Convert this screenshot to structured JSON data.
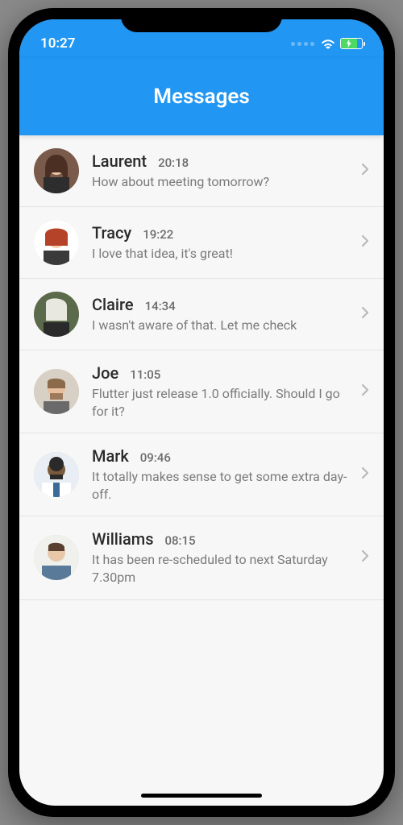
{
  "statusbar": {
    "time": "10:27"
  },
  "appbar": {
    "title": "Messages"
  },
  "conversations": [
    {
      "name": "Laurent",
      "time": "20:18",
      "preview": "How about meeting tomorrow?",
      "avatar": "avatar-1"
    },
    {
      "name": "Tracy",
      "time": "19:22",
      "preview": "I love that idea, it's great!",
      "avatar": "avatar-2"
    },
    {
      "name": "Claire",
      "time": "14:34",
      "preview": "I wasn't aware of that. Let me check",
      "avatar": "avatar-3"
    },
    {
      "name": "Joe",
      "time": "11:05",
      "preview": "Flutter just release 1.0 officially. Should I go for it?",
      "avatar": "avatar-4"
    },
    {
      "name": "Mark",
      "time": "09:46",
      "preview": "It totally makes sense to get some extra day-off.",
      "avatar": "avatar-5"
    },
    {
      "name": "Williams",
      "time": "08:15",
      "preview": "It has been re-scheduled to next Saturday 7.30pm",
      "avatar": "avatar-6"
    }
  ]
}
